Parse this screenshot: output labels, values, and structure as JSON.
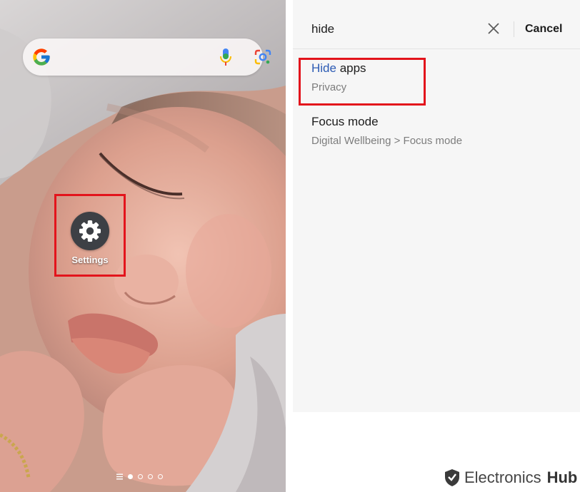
{
  "home_screen": {
    "search_widget": {
      "logo_icon": "google-g-icon",
      "mic_icon": "microphone-icon",
      "lens_icon": "google-lens-icon"
    },
    "settings_app": {
      "label": "Settings",
      "icon": "gear-icon"
    },
    "page_indicator": {
      "menu_icon": "app-drawer-icon",
      "pages": 4,
      "active_page": 1
    }
  },
  "settings_search": {
    "query": "hide",
    "clear_icon": "close-icon",
    "cancel_label": "Cancel",
    "results": [
      {
        "title_match": "Hide",
        "title_rest": " apps",
        "subtitle": "Privacy"
      },
      {
        "title_match": "",
        "title_rest": "Focus mode",
        "subtitle": "Digital Wellbeing > Focus mode"
      }
    ]
  },
  "watermark": {
    "brand_part1": "Electronics",
    "brand_part2": "Hub",
    "icon": "shield-logo-icon"
  },
  "colors": {
    "highlight_box": "#e3141c",
    "match_text": "#2c5bb4",
    "settings_icon_bg": "#3d4045"
  }
}
